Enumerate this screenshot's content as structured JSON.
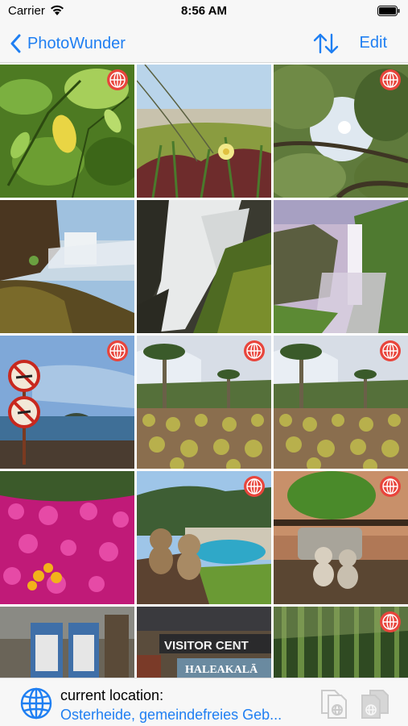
{
  "status": {
    "carrier": "Carrier",
    "time": "8:56 AM"
  },
  "nav": {
    "back_label": "PhotoWunder",
    "edit_label": "Edit",
    "sort_icon": "sort-arrows-icon"
  },
  "tiles": [
    {
      "name": "lemon-tree",
      "globe": true
    },
    {
      "name": "dune-flower",
      "globe": false
    },
    {
      "name": "tree-canopy-sun",
      "globe": true
    },
    {
      "name": "waterfall-cliff",
      "globe": false
    },
    {
      "name": "waterfall-longexposure",
      "globe": false
    },
    {
      "name": "waterfall-gorge",
      "globe": false
    },
    {
      "name": "no-swimming-signs",
      "globe": true
    },
    {
      "name": "cactus-garden-1",
      "globe": true
    },
    {
      "name": "cactus-garden-2",
      "globe": true
    },
    {
      "name": "pink-flowers",
      "globe": false
    },
    {
      "name": "teddies-at-pool",
      "globe": true
    },
    {
      "name": "teddies-on-table",
      "globe": true
    },
    {
      "name": "recycling-bins",
      "globe": false
    },
    {
      "name": "visitor-center-sign",
      "globe": false
    },
    {
      "name": "bamboo-forest",
      "globe": true
    }
  ],
  "visitor_sign": {
    "line1": "VISITOR CENT",
    "line2": "HALEAKALĀ"
  },
  "bottom": {
    "label": "current location:",
    "value": "Osterheide, gemeindefreies Geb...",
    "icon": "globe-icon"
  },
  "colors": {
    "accent": "#1f7ff2",
    "badge": "#e8453c"
  }
}
